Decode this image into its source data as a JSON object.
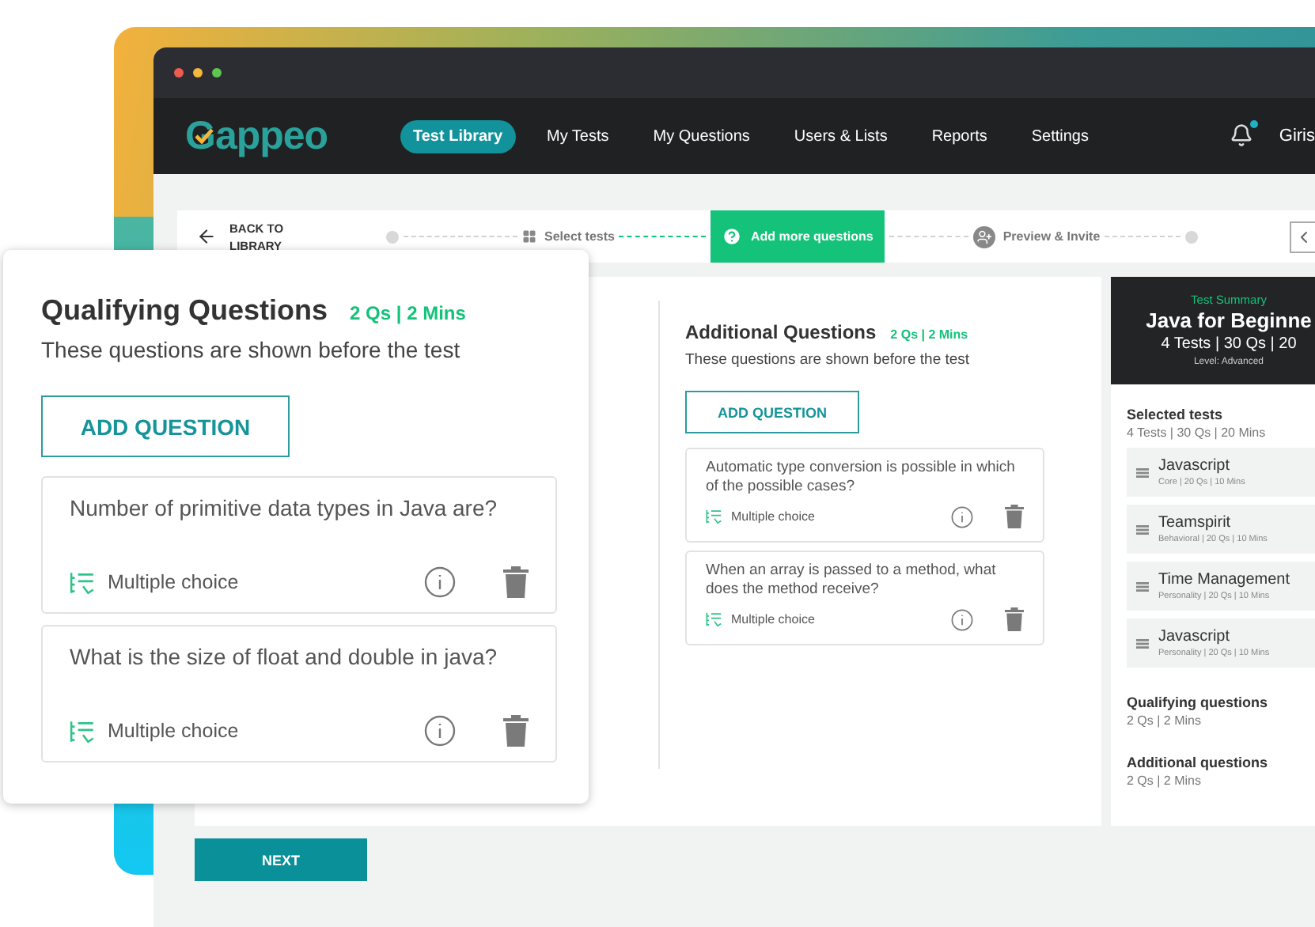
{
  "nav": {
    "logo": "Gappeo",
    "items": [
      {
        "label": "Test Library",
        "selected": true
      },
      {
        "label": "My Tests",
        "selected": false
      },
      {
        "label": "My Questions",
        "selected": false
      },
      {
        "label": "Users  & Lists",
        "selected": false
      },
      {
        "label": "Reports",
        "selected": false
      },
      {
        "label": "Settings",
        "selected": false
      }
    ],
    "notification": true,
    "user": "Giris"
  },
  "back_link": "BACK TO LIBRARY",
  "steps": [
    {
      "label": "Select tests",
      "kind": "grid",
      "selected": false
    },
    {
      "label": "Add more questions",
      "kind": "question",
      "selected": true
    },
    {
      "label": "Preview  & Invite",
      "kind": "person",
      "selected": false
    }
  ],
  "additional": {
    "title": "Additional Questions",
    "meta": "2 Qs | 2 Mins",
    "subtitle": "These questions are shown before the test",
    "button": "ADD QUESTION",
    "questions": [
      {
        "text": "Automatic type conversion is possible in which of the possible cases?",
        "type": "Multiple choice"
      },
      {
        "text": "When an array is passed to a method, what does the method receive?",
        "type": "Multiple choice"
      }
    ]
  },
  "summary": {
    "caption": "Test Summary",
    "title": "Java for Beginne",
    "stats": "4 Tests | 30 Qs | 20",
    "level": "Level: Advanced",
    "selected_title": "Selected tests",
    "selected_meta": "4 Tests | 30 Qs | 20 Mins",
    "tests": [
      {
        "name": "Javascript",
        "meta": "Core | 20 Qs | 10 Mins"
      },
      {
        "name": "Teamspirit",
        "meta": "Behavioral | 20 Qs | 10 Mins"
      },
      {
        "name": "Time Management",
        "meta": "Personality | 20 Qs | 10 Mins"
      },
      {
        "name": "Javascript",
        "meta": "Personality | 20 Qs | 10 Mins"
      }
    ],
    "sections": [
      {
        "title": "Qualifying questions",
        "meta": "2 Qs | 2 Mins"
      },
      {
        "title": "Additional questions",
        "meta": "2 Qs | 2 Mins"
      }
    ]
  },
  "next_button": "NEXT",
  "qualifying": {
    "title": "Qualifying Questions",
    "meta": "2 Qs | 2 Mins",
    "subtitle": "These questions are shown before the test",
    "button": "ADD QUESTION",
    "questions": [
      {
        "text": "Number of primitive data types in Java are?",
        "type": "Multiple choice"
      },
      {
        "text": "What is the size of float and double in java?",
        "type": "Multiple choice"
      }
    ]
  }
}
